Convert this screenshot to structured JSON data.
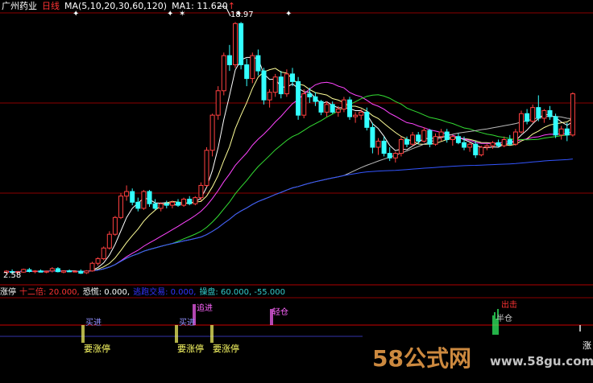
{
  "header": {
    "stock_name": "广州药业",
    "period": "日线",
    "ma_label": "MA(5,10,20,30,60,120)",
    "ma1_label": "MA1: 11.620",
    "ma1_arrow": "↑",
    "markers": [
      "✦",
      "✦",
      "✶",
      "✦",
      "✦"
    ]
  },
  "annotations": {
    "peak_price": "18.97",
    "low_price": "2.58",
    "corner_mark": "涨"
  },
  "indicator": {
    "items": [
      {
        "label": "涨停",
        "color": "#ffffff"
      },
      {
        "label": "十二倍: 20.000,",
        "color": "#ff3333"
      },
      {
        "label": "恐慌: 0.000,",
        "color": "#ffffff"
      },
      {
        "label": "逃跑交易: 0.000,",
        "color": "#3333ff"
      },
      {
        "label": "操盘: 60.000, -55.000",
        "color": "#33cccc"
      }
    ]
  },
  "signals": [
    {
      "text": "买进",
      "color": "#9090ff"
    },
    {
      "text": "买进",
      "color": "#9090ff"
    },
    {
      "text": "追进",
      "color": "#ff66ff"
    },
    {
      "text": "轻仓",
      "color": "#ff66ff"
    },
    {
      "text": "出击",
      "color": "#ff3333"
    },
    {
      "text": "半仓",
      "color": "#cccccc"
    },
    {
      "text": "要涨停",
      "color": "#ffff66"
    },
    {
      "text": "要涨停",
      "color": "#ffff66"
    },
    {
      "text": "要涨停",
      "color": "#ffff66"
    }
  ],
  "watermark": {
    "text": "58公式网",
    "url": "www.58gu.com"
  },
  "chart_data": {
    "type": "candlestick",
    "ylim": [
      2.0,
      19.6
    ],
    "ohlc": [
      [
        2.6,
        2.75,
        2.5,
        2.68
      ],
      [
        2.65,
        2.8,
        2.55,
        2.6
      ],
      [
        2.6,
        2.7,
        2.5,
        2.65
      ],
      [
        2.62,
        2.85,
        2.58,
        2.8
      ],
      [
        2.78,
        2.9,
        2.6,
        2.66
      ],
      [
        2.66,
        2.75,
        2.55,
        2.7
      ],
      [
        2.7,
        2.8,
        2.6,
        2.62
      ],
      [
        2.62,
        2.72,
        2.55,
        2.68
      ],
      [
        2.7,
        2.95,
        2.6,
        2.85
      ],
      [
        2.85,
        2.95,
        2.6,
        2.65
      ],
      [
        2.62,
        2.75,
        2.55,
        2.7
      ],
      [
        2.7,
        2.8,
        2.62,
        2.64
      ],
      [
        2.64,
        2.72,
        2.6,
        2.68
      ],
      [
        2.68,
        2.8,
        2.5,
        2.55
      ],
      [
        2.58,
        2.75,
        2.5,
        2.7
      ],
      [
        2.7,
        3.3,
        2.65,
        3.2
      ],
      [
        3.2,
        3.6,
        3.05,
        3.5
      ],
      [
        3.5,
        4.3,
        3.4,
        4.2
      ],
      [
        4.2,
        5.3,
        4.1,
        5.1
      ],
      [
        5.1,
        6.3,
        5.0,
        6.2
      ],
      [
        6.2,
        7.8,
        6.1,
        7.6
      ],
      [
        7.6,
        8.3,
        7.3,
        7.9
      ],
      [
        7.9,
        8.1,
        7.0,
        7.2
      ],
      [
        7.2,
        7.5,
        6.6,
        6.8
      ],
      [
        6.8,
        8.0,
        6.7,
        7.9
      ],
      [
        7.9,
        8.0,
        6.9,
        7.1
      ],
      [
        7.1,
        7.4,
        6.7,
        6.8
      ],
      [
        6.8,
        7.2,
        6.6,
        7.1
      ],
      [
        7.1,
        7.3,
        6.8,
        7.0
      ],
      [
        7.0,
        7.3,
        6.8,
        7.2
      ],
      [
        7.2,
        7.4,
        6.9,
        7.0
      ],
      [
        7.0,
        7.5,
        6.9,
        7.4
      ],
      [
        7.4,
        7.6,
        7.0,
        7.1
      ],
      [
        7.1,
        7.6,
        7.0,
        7.5
      ],
      [
        7.5,
        8.5,
        7.3,
        8.3
      ],
      [
        8.3,
        10.8,
        8.2,
        10.6
      ],
      [
        10.6,
        13.0,
        10.2,
        12.9
      ],
      [
        12.9,
        14.8,
        12.6,
        14.5
      ],
      [
        14.5,
        17.0,
        14.2,
        16.8
      ],
      [
        16.8,
        17.5,
        15.8,
        16.2
      ],
      [
        16.2,
        19.0,
        16.0,
        18.9
      ],
      [
        18.9,
        19.0,
        15.9,
        16.2
      ],
      [
        16.2,
        16.6,
        14.8,
        15.3
      ],
      [
        15.3,
        17.0,
        15.0,
        16.8
      ],
      [
        16.8,
        17.2,
        15.5,
        15.8
      ],
      [
        15.8,
        16.0,
        13.6,
        13.9
      ],
      [
        13.9,
        14.6,
        13.4,
        14.4
      ],
      [
        14.4,
        15.6,
        14.1,
        15.4
      ],
      [
        15.4,
        15.8,
        14.0,
        14.3
      ],
      [
        14.3,
        15.9,
        14.1,
        15.6
      ],
      [
        15.6,
        16.0,
        14.8,
        15.1
      ],
      [
        15.1,
        15.4,
        12.6,
        12.9
      ],
      [
        12.9,
        14.6,
        12.7,
        14.3
      ],
      [
        14.3,
        14.7,
        13.7,
        14.1
      ],
      [
        14.1,
        14.4,
        13.5,
        13.8
      ],
      [
        13.8,
        13.9,
        12.9,
        13.1
      ],
      [
        13.1,
        13.8,
        12.8,
        13.6
      ],
      [
        13.6,
        13.8,
        13.0,
        13.1
      ],
      [
        13.1,
        13.5,
        12.8,
        13.3
      ],
      [
        13.3,
        14.1,
        13.1,
        13.9
      ],
      [
        13.9,
        14.1,
        12.6,
        12.8
      ],
      [
        12.8,
        13.1,
        12.4,
        12.9
      ],
      [
        12.9,
        13.3,
        12.6,
        13.1
      ],
      [
        13.1,
        13.4,
        11.9,
        12.1
      ],
      [
        12.1,
        12.4,
        10.4,
        10.8
      ],
      [
        10.8,
        11.4,
        10.3,
        11.2
      ],
      [
        11.2,
        11.5,
        10.2,
        10.4
      ],
      [
        10.4,
        10.8,
        9.9,
        10.1
      ],
      [
        10.1,
        10.5,
        9.8,
        10.4
      ],
      [
        10.4,
        11.5,
        10.2,
        11.3
      ],
      [
        11.3,
        11.5,
        10.8,
        11.0
      ],
      [
        11.0,
        11.8,
        10.9,
        11.6
      ],
      [
        11.6,
        11.8,
        11.0,
        11.2
      ],
      [
        11.2,
        12.1,
        11.1,
        11.9
      ],
      [
        11.9,
        12.0,
        10.8,
        11.0
      ],
      [
        11.0,
        11.7,
        10.9,
        11.5
      ],
      [
        11.5,
        12.0,
        11.2,
        11.8
      ],
      [
        11.8,
        12.0,
        11.1,
        11.3
      ],
      [
        11.3,
        11.6,
        10.9,
        11.5
      ],
      [
        11.5,
        11.7,
        11.0,
        11.1
      ],
      [
        11.1,
        11.5,
        10.6,
        10.8
      ],
      [
        10.8,
        11.1,
        10.5,
        11.0
      ],
      [
        11.0,
        11.2,
        10.1,
        10.3
      ],
      [
        10.3,
        10.9,
        10.2,
        10.8
      ],
      [
        10.8,
        11.0,
        10.6,
        10.9
      ],
      [
        10.9,
        11.2,
        10.7,
        11.1
      ],
      [
        11.1,
        11.3,
        10.8,
        10.9
      ],
      [
        10.9,
        11.5,
        10.8,
        11.3
      ],
      [
        11.3,
        11.6,
        10.9,
        11.0
      ],
      [
        11.0,
        12.0,
        10.9,
        11.8
      ],
      [
        11.8,
        13.2,
        11.7,
        13.0
      ],
      [
        13.0,
        13.3,
        12.3,
        12.5
      ],
      [
        12.5,
        13.6,
        12.4,
        13.4
      ],
      [
        13.4,
        14.2,
        12.5,
        12.7
      ],
      [
        12.7,
        13.3,
        12.4,
        13.2
      ],
      [
        13.2,
        13.5,
        12.6,
        12.8
      ],
      [
        12.8,
        13.0,
        11.4,
        11.6
      ],
      [
        11.6,
        12.2,
        11.3,
        12.0
      ],
      [
        12.0,
        12.4,
        11.2,
        11.6
      ],
      [
        11.6,
        14.4,
        11.5,
        14.3
      ]
    ]
  }
}
